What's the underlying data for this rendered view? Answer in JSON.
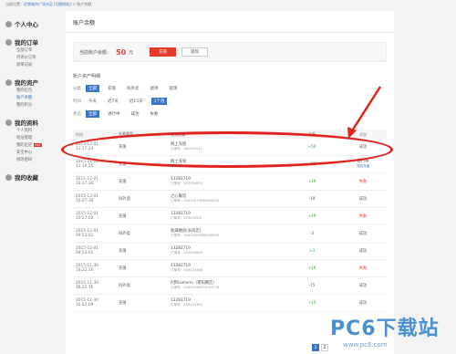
{
  "breadcrumb": {
    "prefix": "当前位置：",
    "city": "近铁城市广场东区",
    "switch": "[切换地址]",
    "sep": " > ",
    "current": "账户余额"
  },
  "sidebar": [
    {
      "title": "个人中心",
      "icon": "user-icon",
      "items": []
    },
    {
      "title": "我的订单",
      "icon": "order-icon",
      "items": [
        "全部订单",
        "待评价订单",
        "退单记录"
      ]
    },
    {
      "title": "我的资产",
      "icon": "wallet-icon",
      "items": [
        "我的红包",
        "账户余额",
        "我的积分"
      ],
      "active": "账户余额"
    },
    {
      "title": "我的资料",
      "icon": "profile-icon",
      "items": [
        "个人资料",
        "地址管理",
        "我的足迹",
        "安全中心",
        "修改密码"
      ],
      "hot": "HOT"
    },
    {
      "title": "我的收藏",
      "icon": "heart-icon",
      "items": []
    }
  ],
  "main": {
    "title": "账户余额",
    "balance_label": "当前账户余额：",
    "balance_amount": "50",
    "balance_unit": "元",
    "recharge_label": "充值",
    "withdraw_label": "提现",
    "detail_title": "账户资产明细"
  },
  "filters": {
    "category": {
      "label": "分类",
      "options": [
        "全部",
        "充值",
        "叫外卖",
        "退单",
        "提现"
      ],
      "selected": 0
    },
    "time": {
      "label": "时间",
      "options": [
        "今天",
        "近7天",
        "近15天",
        "1个月"
      ],
      "selected": 3
    },
    "status": {
      "label": "状态",
      "options": [
        "全部",
        "进行中",
        "成功",
        "失败"
      ],
      "selected": 0
    }
  },
  "table": {
    "headers": [
      "时间",
      "交易类型",
      "交易详情",
      "金额",
      "状态"
    ],
    "rows": [
      {
        "date": "2015-12-01",
        "time": "11:17:24",
        "type": "充值",
        "detail": "网上充值",
        "order": "订单号：461559211",
        "amount": "+50",
        "status": "成功",
        "status_class": "st-ok",
        "amount_class": "pos"
      },
      {
        "date": "2015-12-01",
        "time": "11:10:15",
        "type": "充值",
        "detail": "网上充值",
        "order": "订单号：461557472",
        "amount": "+50",
        "status": "进行中",
        "status_link": "完成充值",
        "status_class": "st-proc",
        "amount_class": "pos"
      },
      {
        "date": "2015-12-01",
        "time": "10:27:36",
        "type": "充值",
        "detail": "13283719",
        "order": "订单号：452529852",
        "amount": "+19",
        "status": "失败",
        "status_class": "st-fail",
        "amount_class": "pos"
      },
      {
        "date": "2015-12-01",
        "time": "10:27:36",
        "type": "叫外卖",
        "detail": "之心餐馆",
        "order": "订单号：10020573936645229",
        "amount": "-19",
        "status": "成功",
        "status_class": "st-ok",
        "amount_class": "neg"
      },
      {
        "date": "2015-12-01",
        "time": "10:27:02",
        "type": "充值",
        "detail": "13283719",
        "order": "订单号：452529551",
        "amount": "+19",
        "status": "失败",
        "status_class": "st-fail",
        "amount_class": "pos"
      },
      {
        "date": "2015-12-01",
        "time": "09:53:01",
        "type": "叫外卖",
        "detail": "秋满楼房(长风店)",
        "order": "订单号：10020900858208290",
        "amount": "-3",
        "status": "成功",
        "status_class": "st-ok",
        "amount_class": "neg"
      },
      {
        "date": "2015-12-01",
        "time": "09:53:01",
        "type": "充值",
        "detail": "13283719",
        "order": "订单号：450093605",
        "amount": "+3",
        "status": "成功",
        "status_class": "st-ok",
        "amount_class": "pos"
      },
      {
        "date": "2015-11-30",
        "time": "16:22:16",
        "type": "充值",
        "detail": "13283719",
        "order": "订单号：449433398",
        "amount": "+16",
        "status": "失败",
        "status_class": "st-fail",
        "amount_class": "pos"
      },
      {
        "date": "2015-11-30",
        "time": "16:22:16",
        "type": "叫外卖",
        "detail": "A梦Eamonn（枣阳路店）",
        "order": "订单号：10020436524257278",
        "amount": "-15",
        "status": "成功",
        "status_class": "st-ok",
        "amount_class": "neg"
      },
      {
        "date": "2015-11-30",
        "time": "16:22:09",
        "type": "充值",
        "detail": "13283719",
        "order": "订单号：449433392",
        "amount": "+15",
        "status": "成功",
        "status_class": "st-ok",
        "amount_class": "pos"
      }
    ]
  },
  "pager": {
    "pages": [
      "1",
      "2"
    ],
    "current": "1"
  },
  "watermark": {
    "brand": "PC6下载站",
    "url": "www.pc6.com"
  },
  "colors": {
    "accent": "#3a74c4",
    "red": "#e5392b",
    "annotation": "#e0231b",
    "positive": "#3a9a3a"
  }
}
